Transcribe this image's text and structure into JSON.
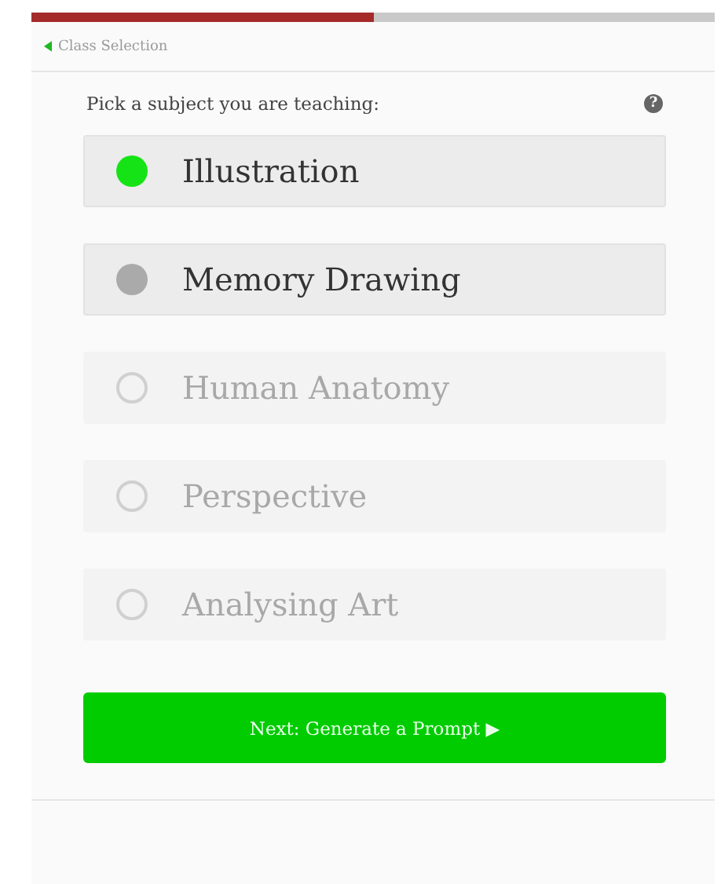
{
  "progress": {
    "level": 0.5
  },
  "back_link": {
    "label": "Class Selection"
  },
  "prompt": {
    "text": "Pick a subject you are teaching:",
    "help": "?"
  },
  "subjects": [
    {
      "label": "Illustration",
      "selected": true,
      "disabled": false
    },
    {
      "label": "Memory Drawing",
      "selected": false,
      "disabled": false
    },
    {
      "label": "Human Anatomy",
      "selected": false,
      "disabled": true
    },
    {
      "label": "Perspective",
      "selected": false,
      "disabled": true
    },
    {
      "label": "Analysing Art",
      "selected": false,
      "disabled": true
    }
  ],
  "next_button": {
    "label": "Next: Generate a Prompt ▶"
  }
}
